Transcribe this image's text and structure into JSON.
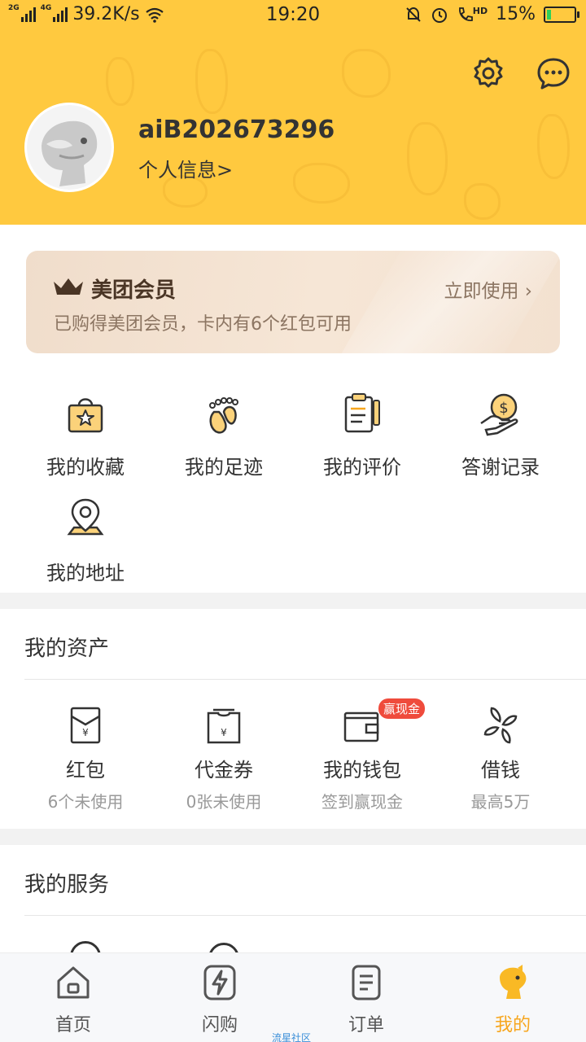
{
  "status_bar": {
    "net1": "2G",
    "net2": "4G",
    "speed": "39.2K/s",
    "time": "19:20",
    "hd": "HD",
    "battery": "15%",
    "battery_level": 0.15
  },
  "header": {
    "username": "aiB202673296",
    "profile_link": "个人信息>",
    "icons": [
      "gear-icon",
      "chat-bubble-icon"
    ]
  },
  "member": {
    "title": "美团会员",
    "subtitle": "已购得美团会员，卡内有6个红包可用",
    "action": "立即使用 ›"
  },
  "quick_links": [
    {
      "label": "我的收藏",
      "icon": "shopping-bag-star-icon"
    },
    {
      "label": "我的足迹",
      "icon": "footprint-icon"
    },
    {
      "label": "我的评价",
      "icon": "clipboard-pen-icon"
    },
    {
      "label": "答谢记录",
      "icon": "coin-hand-icon"
    },
    {
      "label": "我的地址",
      "icon": "location-pin-icon"
    }
  ],
  "assets": {
    "title": "我的资产",
    "items": [
      {
        "label": "红包",
        "sub": "6个未使用",
        "icon": "red-envelope-icon"
      },
      {
        "label": "代金券",
        "sub": "0张未使用",
        "icon": "voucher-icon"
      },
      {
        "label": "我的钱包",
        "sub": "签到赢现金",
        "icon": "wallet-icon",
        "badge": "赢现金"
      },
      {
        "label": "借钱",
        "sub": "最高5万",
        "icon": "loan-icon"
      }
    ]
  },
  "services": {
    "title": "我的服务"
  },
  "nav": {
    "items": [
      {
        "label": "首页",
        "icon": "home-icon"
      },
      {
        "label": "闪购",
        "icon": "flash-icon"
      },
      {
        "label": "订单",
        "icon": "order-icon"
      },
      {
        "label": "我的",
        "icon": "mascot-icon",
        "active": true
      }
    ],
    "watermark": "流星社区"
  },
  "colors": {
    "header_bg": "#ffc93f",
    "accent": "#f7a61e",
    "badge": "#ef4b3c"
  }
}
